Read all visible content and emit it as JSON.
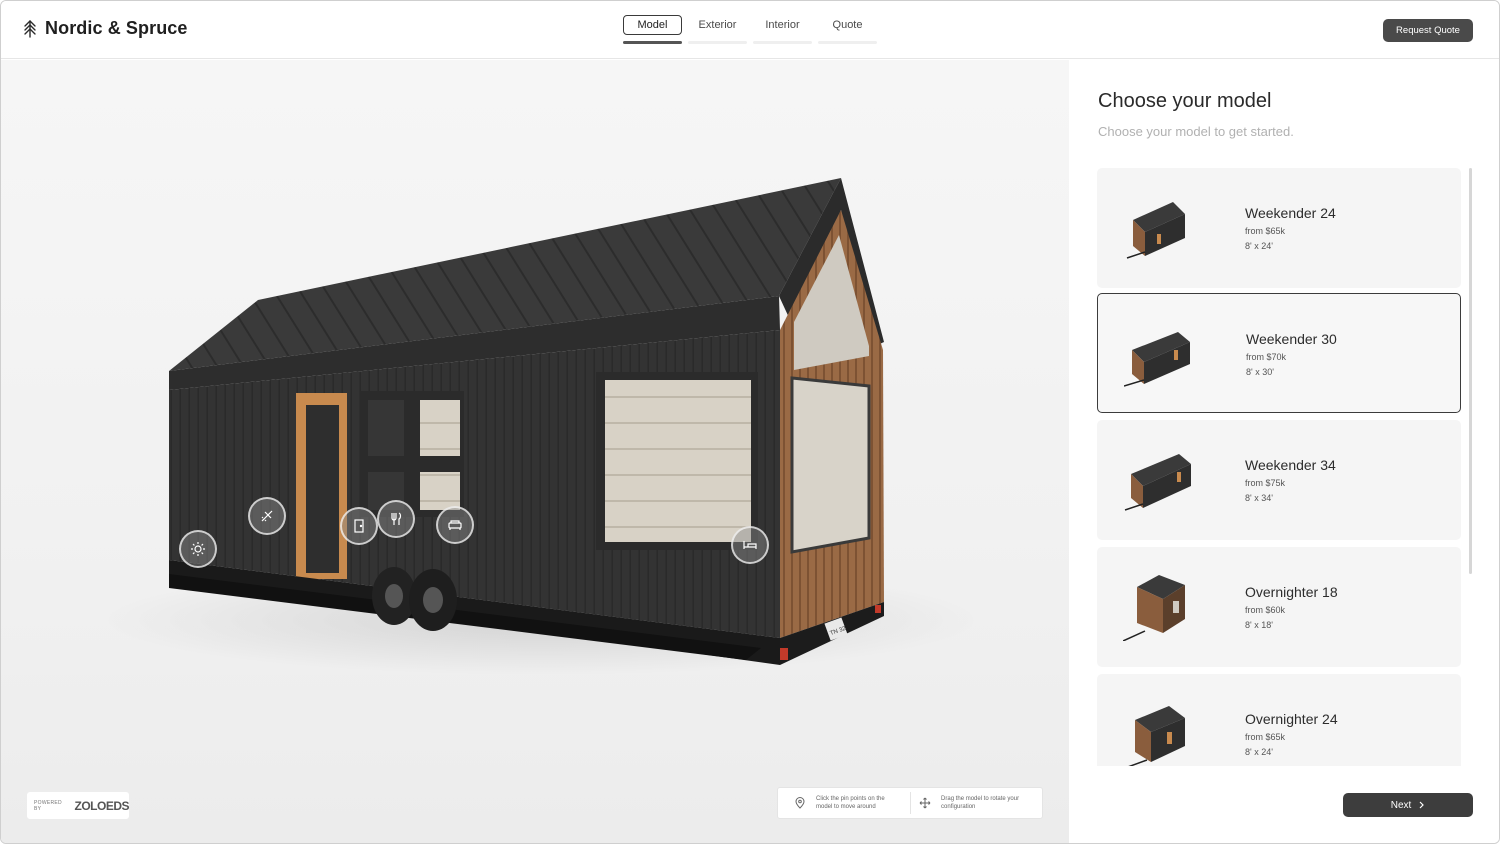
{
  "brand": {
    "name": "Nordic & Spruce",
    "logo_icon": "tree-icon"
  },
  "tabs": [
    {
      "label": "Model",
      "active": true
    },
    {
      "label": "Exterior",
      "active": false
    },
    {
      "label": "Interior",
      "active": false
    },
    {
      "label": "Quote",
      "active": false
    }
  ],
  "header": {
    "request_quote_label": "Request Quote"
  },
  "viewer": {
    "house_plate": "TN 32",
    "hotspots": [
      "sun-icon",
      "shower-icon",
      "door-icon",
      "kitchen-icon",
      "sofa-icon",
      "bed-icon"
    ],
    "powered_by": {
      "label": "POWERED BY",
      "logo": "ZOLOEDS"
    },
    "hints": [
      {
        "icon": "pin-icon",
        "text": "Click the pin points on the model to move around"
      },
      {
        "icon": "move-icon",
        "text": "Drag the model to rotate your configuration"
      }
    ]
  },
  "panel": {
    "title": "Choose your model",
    "subtitle": "Choose your model to get started.",
    "models": [
      {
        "name": "Weekender 24",
        "price": "from $65k",
        "size": "8' x 24'",
        "selected": false,
        "siding": "dark"
      },
      {
        "name": "Weekender 30",
        "price": "from $70k",
        "size": "8' x 30'",
        "selected": true,
        "siding": "dark"
      },
      {
        "name": "Weekender 34",
        "price": "from $75k",
        "size": "8' x 34'",
        "selected": false,
        "siding": "dark"
      },
      {
        "name": "Overnighter 18",
        "price": "from $60k",
        "size": "8' x 18'",
        "selected": false,
        "siding": "wood"
      },
      {
        "name": "Overnighter 24",
        "price": "from $65k",
        "size": "8' x 24'",
        "selected": false,
        "siding": "wood"
      }
    ],
    "next_label": "Next"
  },
  "colors": {
    "accent_dark": "#3d3d3d",
    "selected_border": "#3c3c3c",
    "card_bg": "#f5f5f5"
  }
}
